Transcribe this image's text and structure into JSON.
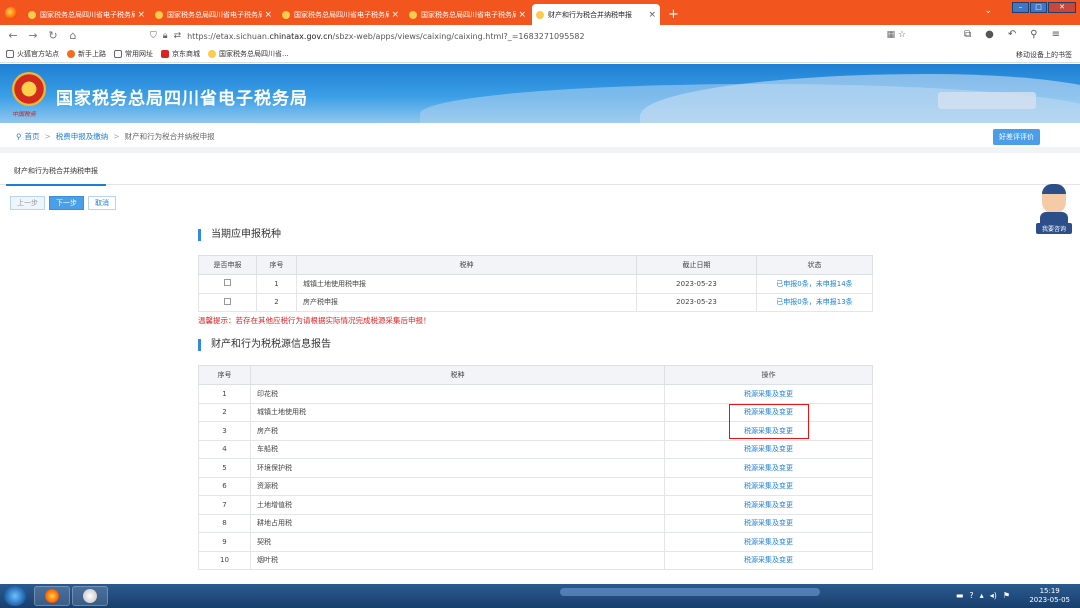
{
  "browser": {
    "tabs": [
      {
        "label": "国家税务总局四川省电子税务局",
        "active": false
      },
      {
        "label": "国家税务总局四川省电子税务局",
        "active": false
      },
      {
        "label": "国家税务总局四川省电子税务局",
        "active": false
      },
      {
        "label": "国家税务总局四川省电子税务局",
        "active": false
      },
      {
        "label": "财产和行为税合并纳税申报",
        "active": true
      }
    ],
    "tab_close": "×",
    "new_tab": "+",
    "url_prefix": "https://etax.sichuan.",
    "url_domain": "chinatax.gov.cn",
    "url_suffix": "/sbzx-web/apps/views/caixing/caixing.html?_=1683271095582",
    "bookmarks": [
      "火狐官方站点",
      "新手上路",
      "常用网址",
      "京东商城",
      "国家税务总局四川省..."
    ],
    "mobile_bookmarks": "移动设备上的书签"
  },
  "site": {
    "title": "国家税务总局四川省电子税务局",
    "emblem_caption": "中国税务"
  },
  "breadcrumb": {
    "home": "首页",
    "level1": "税费申报及缴纳",
    "current": "财产和行为税合并纳税申报",
    "eval_button": "好差评评价"
  },
  "page_tab": "财产和行为税合并纳税申报",
  "buttons": {
    "prev": "上一步",
    "next": "下一步",
    "cancel": "取消"
  },
  "assistant_label": "我要咨询",
  "section1": {
    "title": "当期应申报税种",
    "headers": [
      "是否申报",
      "序号",
      "税种",
      "截止日期",
      "状态"
    ],
    "rows": [
      {
        "no": "1",
        "tax": "城镇土地使用税申报",
        "deadline": "2023-05-23",
        "status": "已申报0条，未申报14条"
      },
      {
        "no": "2",
        "tax": "房产税申报",
        "deadline": "2023-05-23",
        "status": "已申报0条，未申报13条"
      }
    ]
  },
  "warning": "温馨提示：若存在其他应税行为请根据实际情况完成税源采集后申报！",
  "section2": {
    "title": "财产和行为税税源信息报告",
    "headers": [
      "序号",
      "税种",
      "操作"
    ],
    "action_label": "税源采集及变更",
    "rows": [
      {
        "no": "1",
        "tax": "印花税"
      },
      {
        "no": "2",
        "tax": "城镇土地使用税"
      },
      {
        "no": "3",
        "tax": "房产税"
      },
      {
        "no": "4",
        "tax": "车船税"
      },
      {
        "no": "5",
        "tax": "环境保护税"
      },
      {
        "no": "6",
        "tax": "资源税"
      },
      {
        "no": "7",
        "tax": "土地增值税"
      },
      {
        "no": "8",
        "tax": "耕地占用税"
      },
      {
        "no": "9",
        "tax": "契税"
      },
      {
        "no": "10",
        "tax": "烟叶税"
      }
    ]
  },
  "taskbar": {
    "time": "15:19",
    "date": "2023-05-05"
  }
}
